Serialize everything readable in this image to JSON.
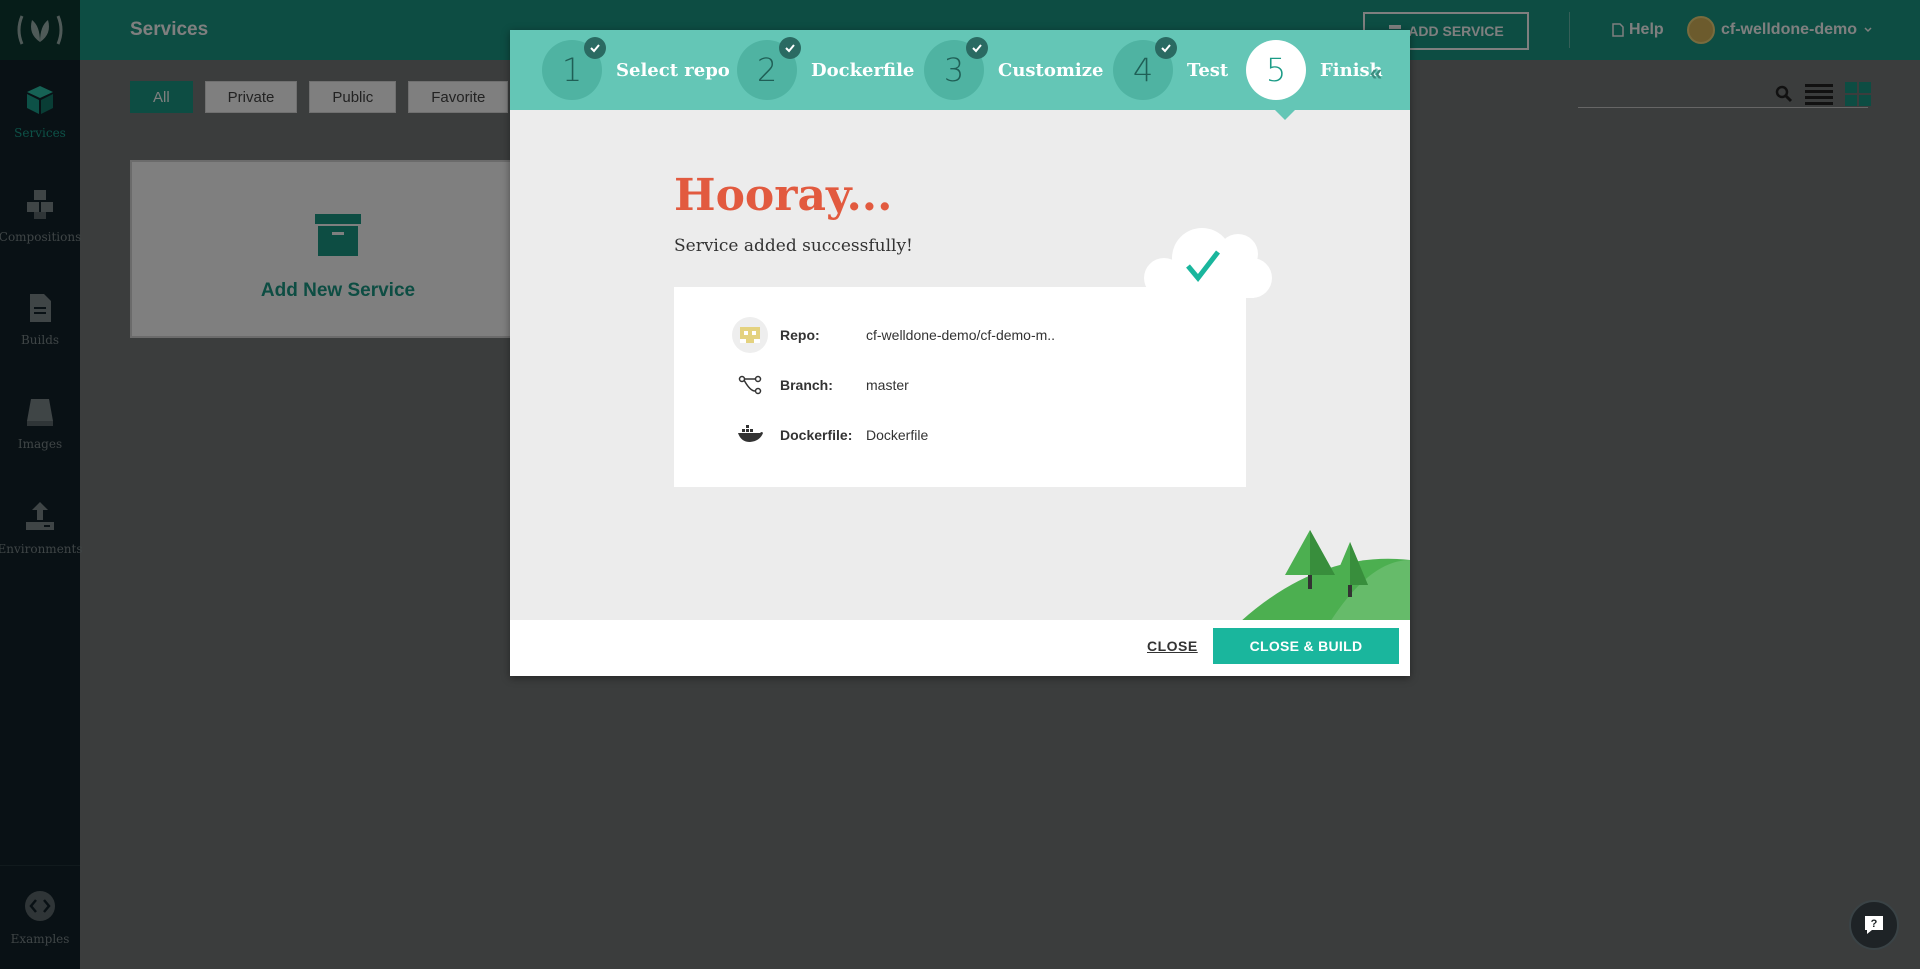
{
  "sidebar": {
    "items": [
      {
        "label": "Services",
        "icon": "cube-icon",
        "active": true
      },
      {
        "label": "Compositions",
        "icon": "cubes-icon"
      },
      {
        "label": "Builds",
        "icon": "document-icon"
      },
      {
        "label": "Images",
        "icon": "disk-icon"
      },
      {
        "label": "Environments",
        "icon": "upload-icon"
      }
    ],
    "bottom": {
      "label": "Examples",
      "icon": "code-icon"
    }
  },
  "header": {
    "title": "Services",
    "add_service": "ADD SERVICE",
    "help": "Help",
    "user": "cf-welldone-demo"
  },
  "filters": [
    "All",
    "Private",
    "Public",
    "Favorite"
  ],
  "card": {
    "label": "Add New Service"
  },
  "modal": {
    "steps": [
      {
        "num": "1",
        "label": "Select repo",
        "done": true
      },
      {
        "num": "2",
        "label": "Dockerfile",
        "done": true
      },
      {
        "num": "3",
        "label": "Customize",
        "done": true
      },
      {
        "num": "4",
        "label": "Test",
        "done": true
      },
      {
        "num": "5",
        "label": "Finish",
        "active": true
      }
    ],
    "close_symbol": "«",
    "heading": "Hooray...",
    "subheading": "Service added successfully!",
    "info": {
      "repo_label": "Repo:",
      "repo_value": "cf-welldone-demo/cf-demo-m..",
      "branch_label": "Branch:",
      "branch_value": "master",
      "dockerfile_label": "Dockerfile:",
      "dockerfile_value": "Dockerfile"
    },
    "footer": {
      "close": "CLOSE",
      "close_build": "CLOSE & BUILD"
    }
  },
  "colors": {
    "brand": "#1b9b86",
    "accent": "#1ab69d",
    "hooray": "#e25a3f",
    "steps_bg": "#64c6b6"
  }
}
